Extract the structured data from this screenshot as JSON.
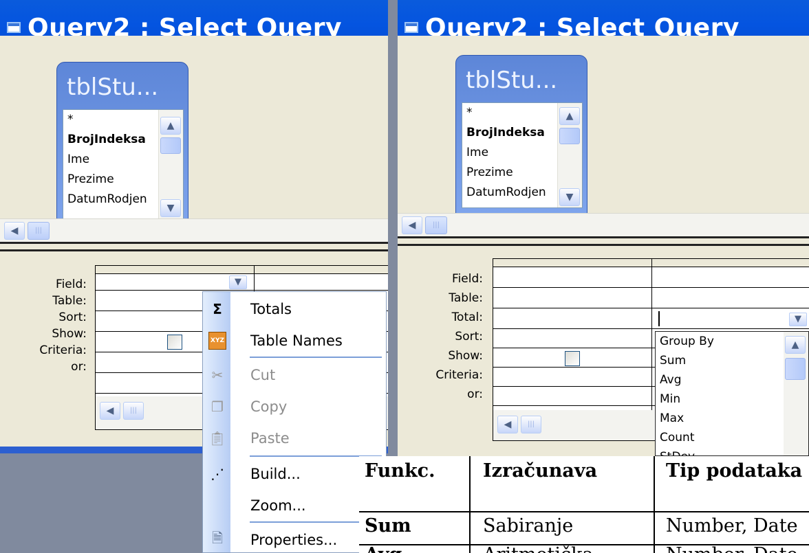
{
  "left_window": {
    "title": "Query2 : Select Query",
    "table_caption": "tblStu...",
    "fields": [
      "*",
      "BrojIndeksa",
      "Ime",
      "Prezime",
      "DatumRodjen"
    ],
    "grid_labels": [
      "Field:",
      "Table:",
      "Sort:",
      "Show:",
      "Criteria:",
      "or:"
    ]
  },
  "context_menu": {
    "totals": "Totals",
    "table_names": "Table Names",
    "cut": "Cut",
    "copy": "Copy",
    "paste": "Paste",
    "build": "Build...",
    "zoom": "Zoom...",
    "properties": "Properties..."
  },
  "right_window": {
    "title": "Query2 : Select Query",
    "table_caption": "tblStu...",
    "fields": [
      "*",
      "BrojIndeksa",
      "Ime",
      "Prezime",
      "DatumRodjen"
    ],
    "grid_labels": [
      "Field:",
      "Table:",
      "Total:",
      "Sort:",
      "Show:",
      "Criteria:",
      "or:"
    ],
    "total_options": [
      "Group By",
      "Sum",
      "Avg",
      "Min",
      "Max",
      "Count",
      "StDev"
    ]
  },
  "doc_table": {
    "headers": [
      "Funkc.",
      "Izračunava",
      "Tip podataka"
    ],
    "row1": [
      "Sum",
      "Sabiranje",
      "Number, Date"
    ],
    "row2": [
      "Avg",
      "Aritmetička",
      "Number, Date"
    ]
  },
  "colors": {
    "title_blue": "#0454e0",
    "menu_gutter": "#b7cdf4",
    "face": "#ece9d8"
  }
}
